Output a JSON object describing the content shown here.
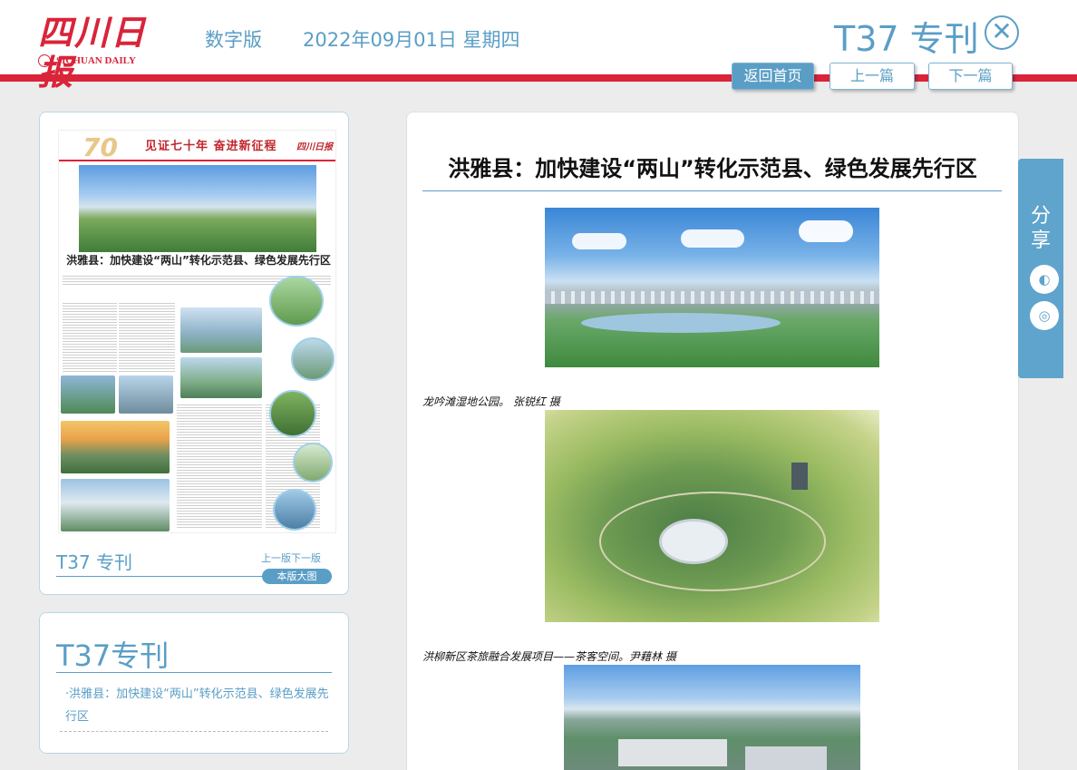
{
  "header": {
    "logo_cn": "四川日报",
    "logo_en": "SICHUAN DAILY",
    "edition": "数字版",
    "date": "2022年09月01日 星期四",
    "page_title": "T37 专刊",
    "close_icon": "close-circle-icon",
    "close_glyph": "✕"
  },
  "nav": {
    "home": "返回首页",
    "prev": "上一篇",
    "next": "下一篇"
  },
  "thumbnail": {
    "slogan": "见证七十年 奋进新征程",
    "anniversary": "70",
    "brand": "四川日报",
    "title": "洪雅县：加快建设“两山”转化示范县、绿色发展先行区",
    "page_label": "T37 专刊",
    "prev_page": "上一版",
    "next_page": "下一版",
    "big_image": "本版大图"
  },
  "section": {
    "title": "T37专刊",
    "items": [
      "·洪雅县：加快建设“两山”转化示范县、绿色发展先行区"
    ]
  },
  "article": {
    "title": "洪雅县：加快建设“两山”转化示范县、绿色发展先行区",
    "captions": [
      "龙吟滩湿地公园。 张锐红 摄",
      "洪柳新区茶旅融合发展项目——茶客空间。尹藉林 摄"
    ]
  },
  "share": {
    "label": "分享",
    "icons": [
      "wechat-icon",
      "weibo-icon"
    ]
  },
  "colors": {
    "accent": "#5a9ec6",
    "brand_red": "#d9243a",
    "background": "#ececec"
  }
}
